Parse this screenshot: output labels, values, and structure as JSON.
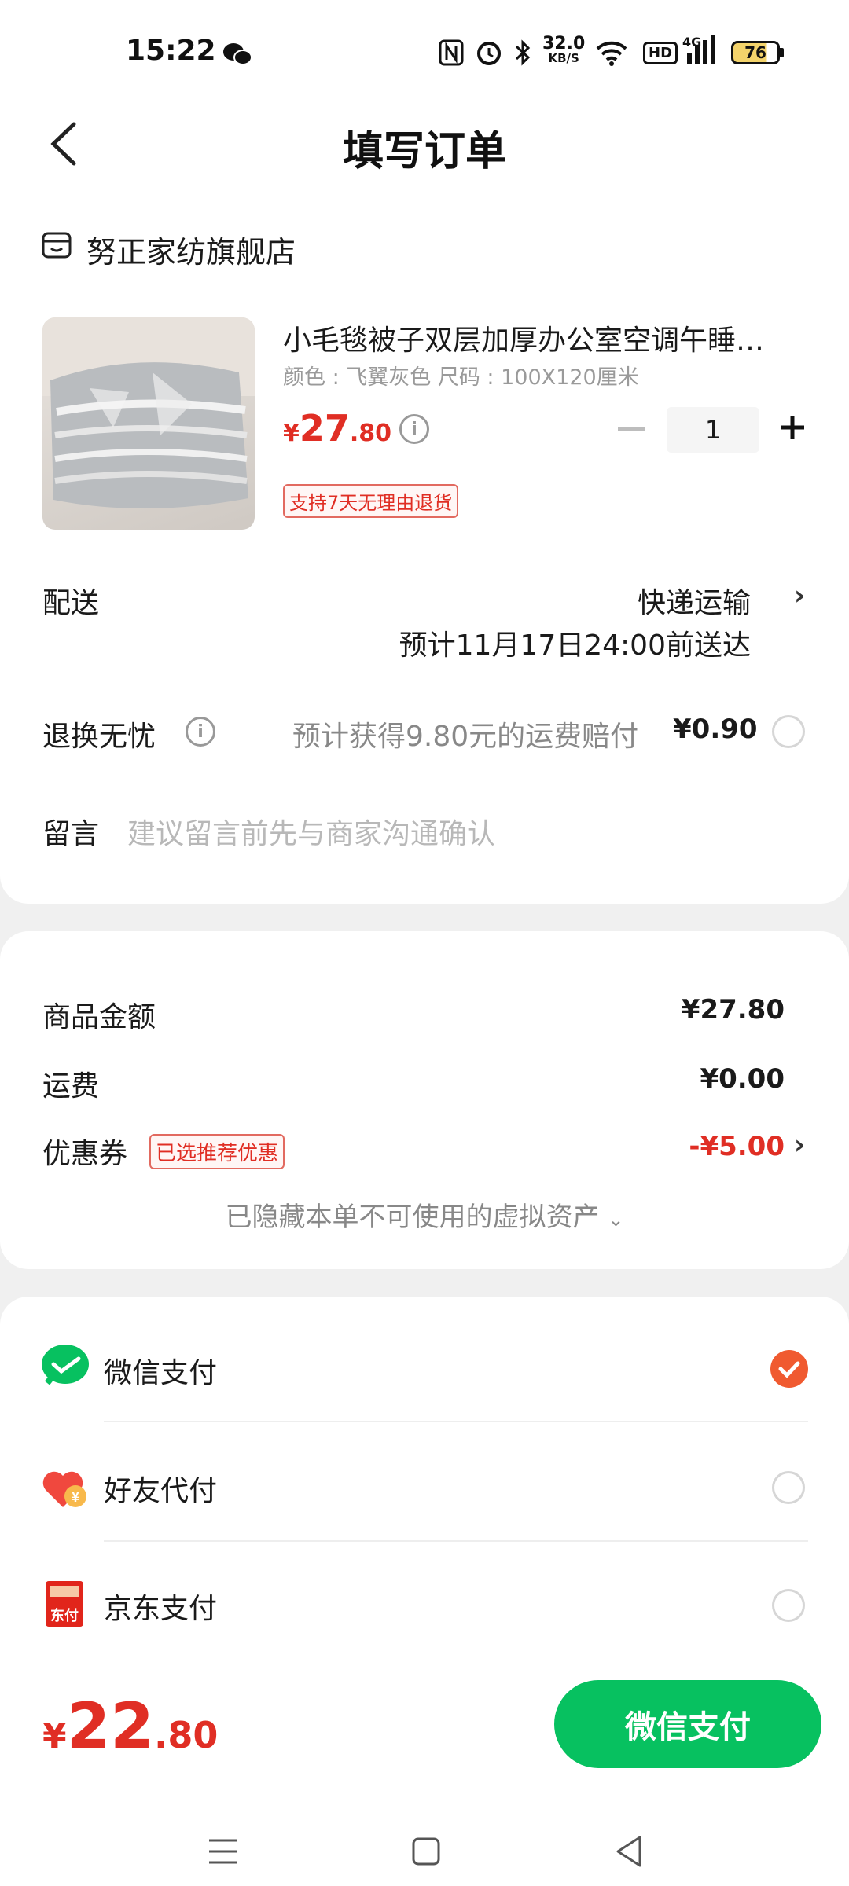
{
  "status_bar": {
    "time": "15:22",
    "net_speed_value": "32.0",
    "net_speed_unit": "KB/S",
    "network": "4G",
    "hd": "HD",
    "battery": "76",
    "icons": [
      "wechat-icon",
      "nfc-icon",
      "alarm-icon",
      "bluetooth-icon",
      "wifi-icon",
      "signal-icon",
      "battery-icon"
    ]
  },
  "header": {
    "title": "填写订单",
    "back_icon": "chevron-left-icon"
  },
  "store": {
    "name": "努正家纺旗舰店",
    "icon": "store-icon"
  },
  "product": {
    "title": "小毛毯被子双层加厚办公室空调午睡…",
    "spec": "颜色 : 飞翼灰色   尺码 : 100X120厘米",
    "price_symbol": "¥",
    "price_int": "27",
    "price_dec": ".80",
    "quantity": "1",
    "return_tag": "支持7天无理由退货"
  },
  "delivery": {
    "label": "配送",
    "method": "快递运输",
    "eta": "预计11月17日24:00前送达"
  },
  "return_insurance": {
    "label": "退换无忧",
    "desc": "预计获得9.80元的运费赔付",
    "price": "¥0.90"
  },
  "message": {
    "label": "留言",
    "placeholder": "建议留言前先与商家沟通确认"
  },
  "summary": {
    "goods_label": "商品金额",
    "goods_value": "¥27.80",
    "shipping_label": "运费",
    "shipping_value": "¥0.00",
    "coupon_label": "优惠券",
    "coupon_tag": "已选推荐优惠",
    "coupon_value": "-¥5.00",
    "hidden_assets": "已隐藏本单不可使用的虚拟资产"
  },
  "payment_methods": [
    {
      "label": "微信支付",
      "selected": true,
      "icon": "wechat-pay-icon"
    },
    {
      "label": "好友代付",
      "selected": false,
      "icon": "friend-pay-heart-icon"
    },
    {
      "label": "京东支付",
      "selected": false,
      "icon": "jd-pay-icon",
      "icon_text": "东付"
    }
  ],
  "footer": {
    "total_symbol": "¥",
    "total_int": "22",
    "total_dec": ".80",
    "pay_button": "微信支付"
  },
  "colors": {
    "accent_red": "#e02e24",
    "wechat_green": "#07c160",
    "check_orange": "#f05a30"
  }
}
